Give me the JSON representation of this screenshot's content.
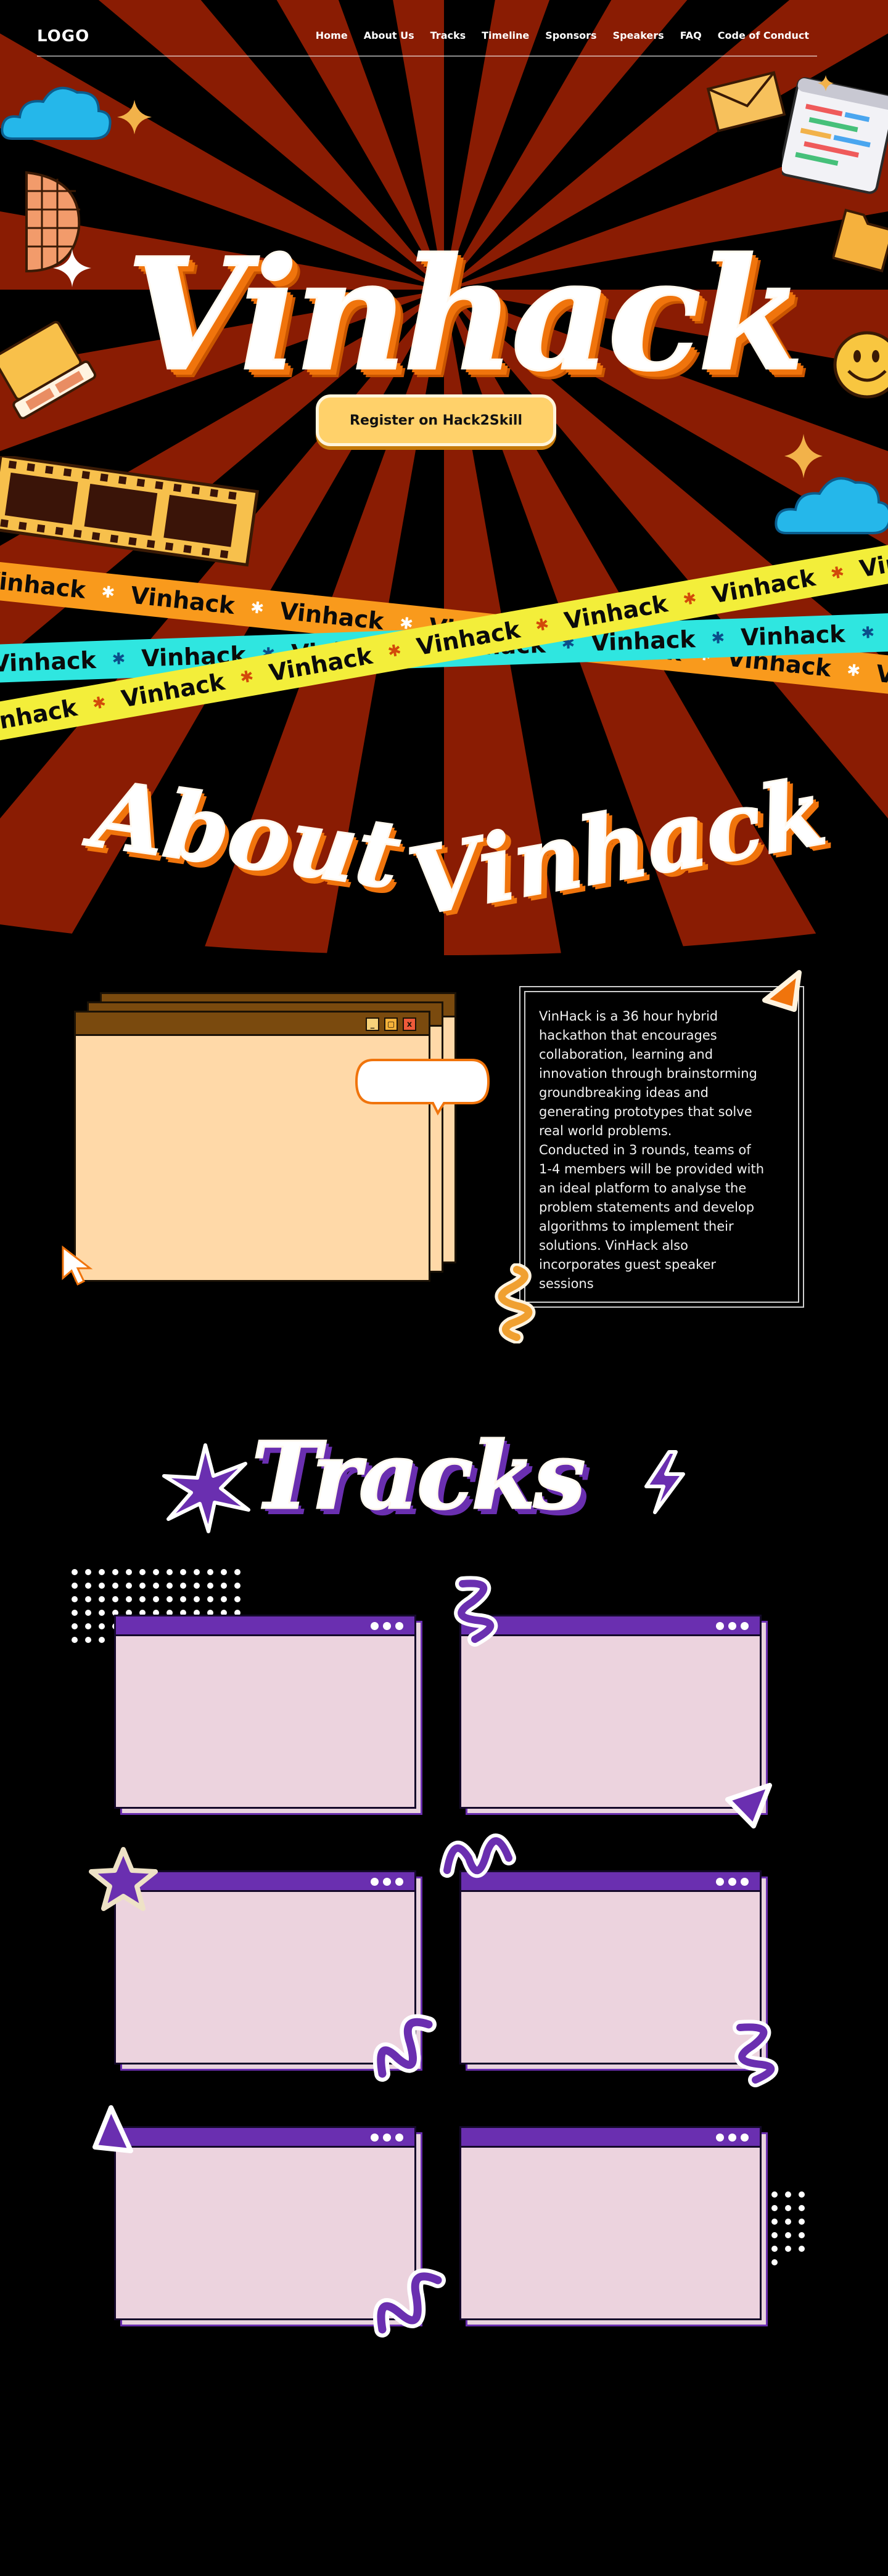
{
  "nav": {
    "logo": "LOGO",
    "links": [
      "Home",
      "About Us",
      "Tracks",
      "Timeline",
      "Sponsors",
      "Speakers",
      "FAQ",
      "Code of Conduct"
    ]
  },
  "hero": {
    "title": "Vinhack",
    "register_label": "Register on Hack2Skill",
    "tape_word": "Vinhack"
  },
  "about": {
    "title_part1": "About",
    "title_part2": "Vinhack",
    "paragraph1": "VinHack is a 36 hour hybrid\nhackathon that encourages\ncollaboration, learning and\ninnovation through brainstorming\ngroundbreaking ideas and\ngenerating prototypes that solve\nreal world problems.",
    "paragraph2": "Conducted in 3 rounds, teams of\n1-4 members will be provided with\nan ideal platform to analyse the\nproblem statements and develop\nalgorithms to implement their\nsolutions. VinHack also\nincorporates guest speaker\nsessions",
    "window_controls": [
      "_",
      "▢",
      "x"
    ]
  },
  "tracks": {
    "title": "Tracks",
    "cards": [
      {},
      {},
      {},
      {},
      {},
      {}
    ]
  },
  "colors": {
    "ray_dark_red": "#8a1c03",
    "accent_orange": "#f0740c",
    "button_yellow": "#ffd16a",
    "tape_orange": "#f99a1c",
    "tape_cyan": "#2fe6e0",
    "tape_yellow": "#f3ee3a",
    "tracks_purple": "#6a2fb0",
    "card_pink": "#ecd3de"
  },
  "icons": [
    "cloud-icon",
    "sparkle-icon",
    "envelope-icon",
    "code-window-icon",
    "folder-icon",
    "smiley-icon",
    "laptop-icon",
    "film-strip-icon",
    "disco-ball-icon",
    "triangle-sticker-icon",
    "squiggle-sticker-icon",
    "cursor-icon",
    "starburst-icon",
    "lightning-icon",
    "star-sticker-icon"
  ]
}
